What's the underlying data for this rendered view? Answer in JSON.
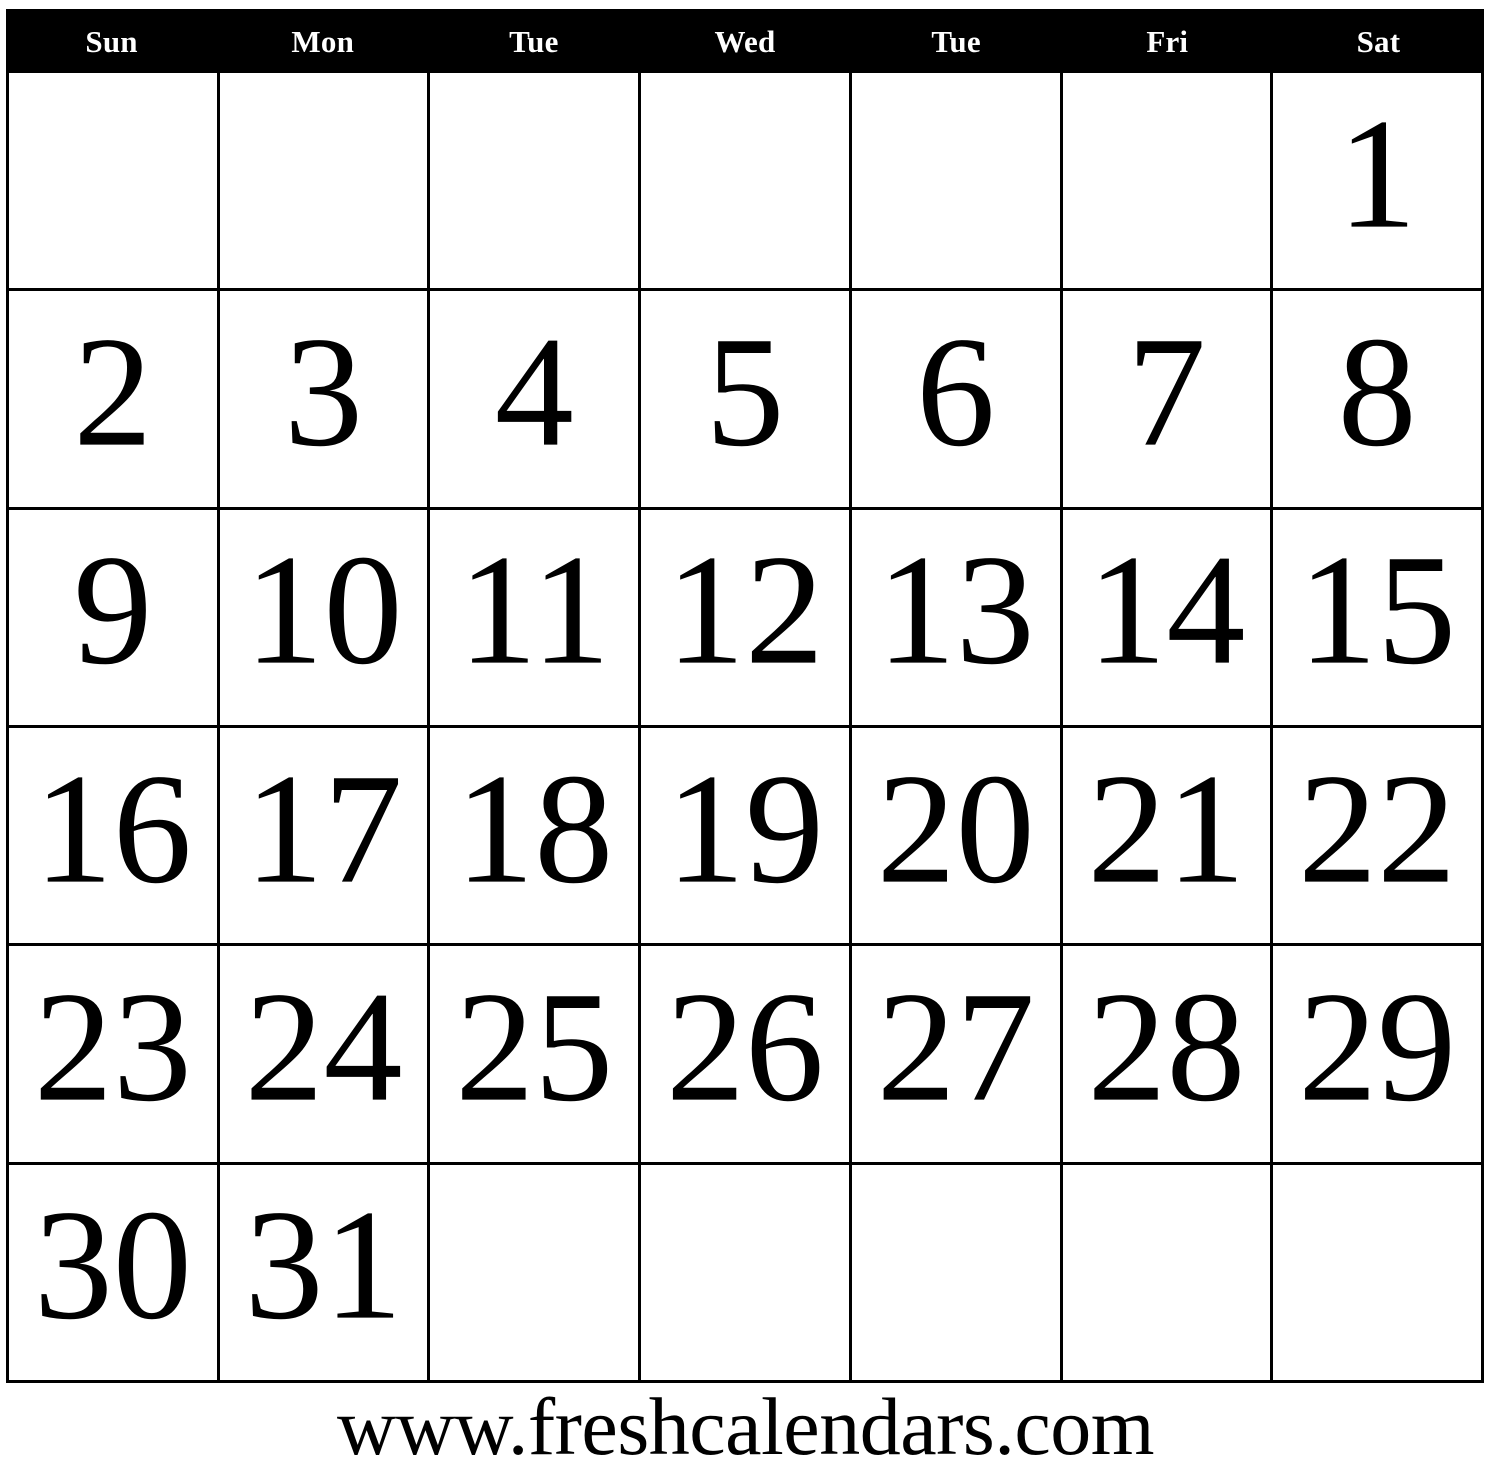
{
  "calendar": {
    "weekday_header": {
      "background_color": "#000000",
      "text_color": "#ffffff",
      "days": [
        {
          "label": "Sun"
        },
        {
          "label": "Mon"
        },
        {
          "label": "Tue"
        },
        {
          "label": "Wed"
        },
        {
          "label": "Tue"
        },
        {
          "label": "Fri"
        },
        {
          "label": "Sat"
        }
      ]
    },
    "grid": {
      "columns": 7,
      "rows": 6,
      "border_color": "#000000",
      "cell_background": "#ffffff",
      "date_text_color": "#000000",
      "weeks": [
        {
          "cells": [
            {
              "date": ""
            },
            {
              "date": ""
            },
            {
              "date": ""
            },
            {
              "date": ""
            },
            {
              "date": ""
            },
            {
              "date": ""
            },
            {
              "date": "1"
            }
          ]
        },
        {
          "cells": [
            {
              "date": "2"
            },
            {
              "date": "3"
            },
            {
              "date": "4"
            },
            {
              "date": "5"
            },
            {
              "date": "6"
            },
            {
              "date": "7"
            },
            {
              "date": "8"
            }
          ]
        },
        {
          "cells": [
            {
              "date": "9"
            },
            {
              "date": "10"
            },
            {
              "date": "11"
            },
            {
              "date": "12"
            },
            {
              "date": "13"
            },
            {
              "date": "14"
            },
            {
              "date": "15"
            }
          ]
        },
        {
          "cells": [
            {
              "date": "16"
            },
            {
              "date": "17"
            },
            {
              "date": "18"
            },
            {
              "date": "19"
            },
            {
              "date": "20"
            },
            {
              "date": "21"
            },
            {
              "date": "22"
            }
          ]
        },
        {
          "cells": [
            {
              "date": "23"
            },
            {
              "date": "24"
            },
            {
              "date": "25"
            },
            {
              "date": "26"
            },
            {
              "date": "27"
            },
            {
              "date": "28"
            },
            {
              "date": "29"
            }
          ]
        },
        {
          "cells": [
            {
              "date": "30"
            },
            {
              "date": "31"
            },
            {
              "date": ""
            },
            {
              "date": ""
            },
            {
              "date": ""
            },
            {
              "date": ""
            },
            {
              "date": ""
            }
          ]
        }
      ]
    },
    "footer": {
      "url": "www.freshcalendars.com"
    }
  }
}
